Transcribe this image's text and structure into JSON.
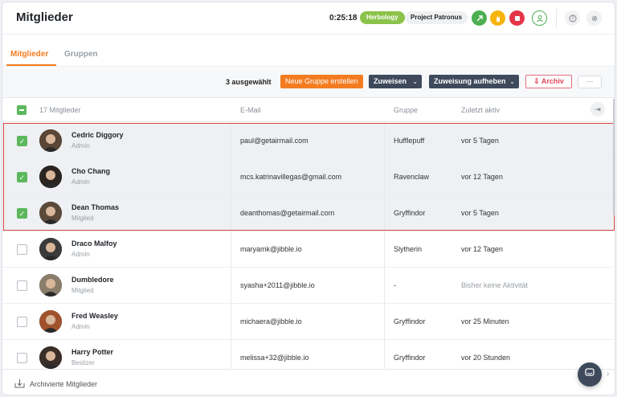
{
  "header": {
    "title": "Mitglieder",
    "timer": "0:25:18",
    "activity_pill": "Herbology",
    "project_pill": "Project Patronus",
    "icons": [
      "clock-in-icon",
      "hand-icon",
      "stop-icon",
      "user-status-icon",
      "help-icon",
      "settings-icon"
    ]
  },
  "tabs": [
    {
      "label": "Mitglieder",
      "active": true
    },
    {
      "label": "Gruppen",
      "active": false
    }
  ],
  "toolbar": {
    "selected_count": "3 ausgewählt",
    "new_group": "Neue Gruppe erstellen",
    "assign": "Zuweisen",
    "unassign": "Zuweisung aufheben",
    "archive": "Archiv",
    "more": "···"
  },
  "table": {
    "col_members": "17 Mitglieder",
    "col_email": "E-Mail",
    "col_group": "Gruppe",
    "col_last_active": "Zuletzt aktiv",
    "rows": [
      {
        "name": "Cedric Diggory",
        "role": "Admin",
        "email": "paul@getairmail.com",
        "group": "Hufflepuff",
        "last": "vor 5 Tagen",
        "selected": true
      },
      {
        "name": "Cho Chang",
        "role": "Admin",
        "email": "mcs.katrinavillegas@gmail.com",
        "group": "Ravenclaw",
        "last": "vor 12 Tagen",
        "selected": true
      },
      {
        "name": "Dean Thomas",
        "role": "Mitglied",
        "email": "deanthomas@getairmail.com",
        "group": "Gryffindor",
        "last": "vor 5 Tagen",
        "selected": true
      },
      {
        "name": "Draco Malfoy",
        "role": "Admin",
        "email": "maryamk@jibble.io",
        "group": "Slytherin",
        "last": "vor 12 Tagen",
        "selected": false
      },
      {
        "name": "Dumbledore",
        "role": "Mitglied",
        "email": "syasha+2011@jibble.io",
        "group": "-",
        "last": "Bisher keine Aktivität",
        "selected": false
      },
      {
        "name": "Fred Weasley",
        "role": "Admin",
        "email": "michaera@jibble.io",
        "group": "Gryffindor",
        "last": "vor 25 Minuten",
        "selected": false
      },
      {
        "name": "Harry Potter",
        "role": "Besitzer",
        "email": "melissa+32@jibble.io",
        "group": "Gryffindor",
        "last": "vor 20 Stunden",
        "selected": false
      }
    ]
  },
  "footer": {
    "archived_members": "Archivierte Mitglieder"
  },
  "colors": {
    "accent": "#f47c20",
    "green": "#5cb85c",
    "dark_button": "#3e4a5c",
    "selection_border": "#e0453f"
  }
}
